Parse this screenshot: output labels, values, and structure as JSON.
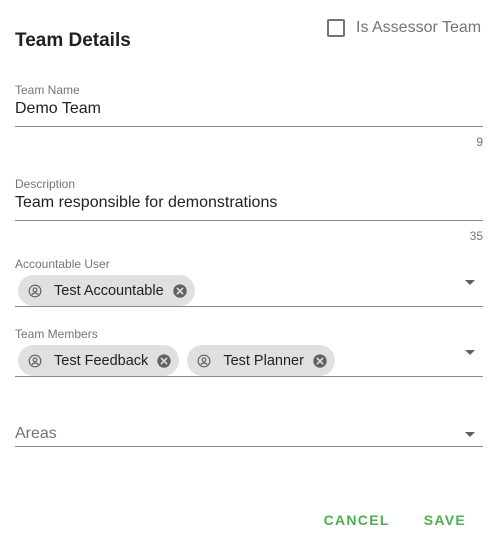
{
  "dialog": {
    "title": "Team Details",
    "assessor_checkbox": {
      "label": "Is Assessor Team",
      "checked": false
    }
  },
  "fields": {
    "team_name": {
      "label": "Team Name",
      "value": "Demo Team",
      "counter": "9"
    },
    "description": {
      "label": "Description",
      "value": "Team responsible for demonstrations",
      "counter": "35"
    },
    "accountable_user": {
      "label": "Accountable User",
      "chips": [
        "Test Accountable"
      ]
    },
    "team_members": {
      "label": "Team Members",
      "chips": [
        "Test Feedback",
        "Test Planner"
      ]
    },
    "areas": {
      "placeholder": "Areas"
    }
  },
  "actions": {
    "cancel": "CANCEL",
    "save": "SAVE"
  },
  "colors": {
    "accent": "#4caf50",
    "chip_bg": "#e0e0e0",
    "label": "#757575"
  },
  "icons": {
    "chip_avatar": "account-circle-icon",
    "chip_close": "close-circle-icon",
    "dropdown": "dropdown-arrow-icon"
  }
}
